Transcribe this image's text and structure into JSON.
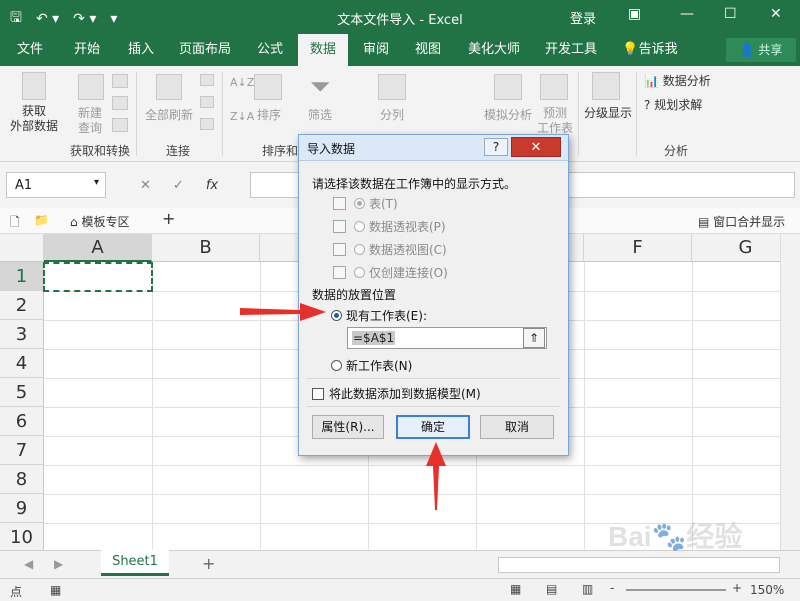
{
  "window": {
    "title": "文本文件导入  -  Excel",
    "login": "登录",
    "quick_access": [
      "save-icon",
      "undo-icon",
      "redo-icon",
      "customize-icon"
    ]
  },
  "ribbon": {
    "tabs": [
      "文件",
      "开始",
      "插入",
      "页面布局",
      "公式",
      "数据",
      "审阅",
      "视图",
      "美化大师",
      "开发工具",
      "告诉我"
    ],
    "active_tab": "数据",
    "share": "共享",
    "buttons": {
      "get_external": "获取\n外部数据",
      "new_query": "新建\n查询",
      "refresh_all": "全部刷新",
      "sort": "排序",
      "filter": "筛选",
      "split": "分列",
      "whatif": "模拟分析",
      "forecast": "预测\n工作表",
      "outline": "分级显示",
      "data_analysis": "数据分析",
      "solver": "规划求解"
    },
    "groups": {
      "get_transform": "获取和转换",
      "connections": "连接",
      "sort_filter": "排序和",
      "analysis": "分析"
    }
  },
  "formula_bar": {
    "name_box": "A1",
    "fx": "fx",
    "cancel": "✕",
    "enter": "✓"
  },
  "tab_strip": {
    "template_zone": "模板专区",
    "add": "+",
    "window_merge": "窗口合并显示"
  },
  "grid": {
    "columns": [
      "A",
      "B",
      "C",
      "D",
      "E",
      "F",
      "G"
    ],
    "rows": [
      "1",
      "2",
      "3",
      "4",
      "5",
      "6",
      "7",
      "8",
      "9",
      "10"
    ],
    "selected_cell": "A1"
  },
  "sheets": {
    "tabs": [
      "Sheet1"
    ],
    "add": "+"
  },
  "status": {
    "mode": "点",
    "zoom": "150%",
    "zoom_minus": "-"
  },
  "dialog": {
    "title": "导入数据",
    "help": "?",
    "close": "✕",
    "prompt": "请选择该数据在工作簿中的显示方式。",
    "display_options": [
      {
        "label": "表(T)",
        "selected": true
      },
      {
        "label": "数据透视表(P)",
        "selected": false
      },
      {
        "label": "数据透视图(C)",
        "selected": false
      },
      {
        "label": "仅创建连接(O)",
        "selected": false
      }
    ],
    "placement_label": "数据的放置位置",
    "existing_sheet": "现有工作表(E):",
    "existing_selected": true,
    "range_value": "=$A$1",
    "new_sheet": "新工作表(N)",
    "add_to_model": "将此数据添加到数据模型(M)",
    "add_to_model_checked": false,
    "btn_properties": "属性(R)...",
    "btn_ok": "确定",
    "btn_cancel": "取消"
  },
  "colors": {
    "excel_green": "#217346",
    "annotation_red": "#e8302a",
    "dialog_title_bg": "#dbe8f7"
  }
}
